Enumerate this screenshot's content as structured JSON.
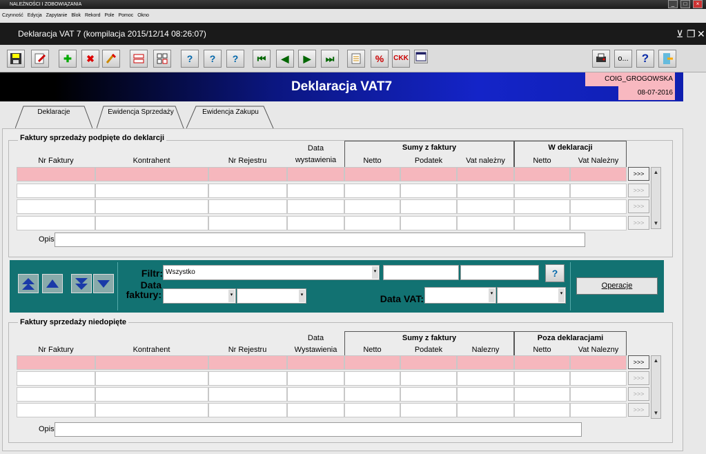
{
  "window": {
    "title": "NALEŻNOŚCI I ZOBOWIĄZANIA"
  },
  "menu": [
    "Czynność",
    "Edycja",
    "Zapytanie",
    "Blok",
    "Rekord",
    "Pole",
    "Pomoc",
    "Okno"
  ],
  "form": {
    "title": "Deklaracja VAT 7 (kompilacja 2015/12/14 08:26:07)"
  },
  "toolbar": {
    "icons": [
      "save-icon",
      "edit-icon",
      "add-icon",
      "delete-icon",
      "clear-icon",
      "duplicate-icon",
      "grid-icon",
      "query-icon",
      "query-exec-icon",
      "query-count-icon",
      "first-record-icon",
      "prev-record-icon",
      "next-record-icon",
      "last-record-icon",
      "list-icon",
      "percent-icon",
      "check-icon",
      "window-icon",
      "print-icon",
      "more-icon",
      "help-icon",
      "exit-icon"
    ],
    "more_label": "o..."
  },
  "banner": {
    "title": "Deklaracja VAT7",
    "user": "COIG_GROGOWSKA",
    "date": "08-07-2016"
  },
  "tabs": [
    "Deklaracje",
    "Ewidencja Sprzedaży",
    "Ewidencja Zakupu"
  ],
  "section1": {
    "title": "Faktury sprzedaży podpięte do deklarcji",
    "group1": "Sumy z faktury",
    "group2": "W deklaracji",
    "columns": [
      "Nr Faktury",
      "Kontrahent",
      "Nr Rejestru",
      "Data wystawienia",
      "Netto",
      "Podatek",
      "Vat należny",
      "Netto",
      "Vat Należny"
    ],
    "row_button": ">>>",
    "opis_label": "Opis"
  },
  "filter": {
    "filtr_label": "Filtr:",
    "filtr_value": "Wszystko",
    "data_faktury_label": "Data faktury:",
    "data_vat_label": "Data VAT:",
    "operacje_label": "Operacje"
  },
  "section2": {
    "title": "Faktury sprzedaży niedopięte",
    "group1": "Sumy z faktury",
    "group2": "Poza deklaracjami",
    "columns": [
      "Nr Faktury",
      "Kontrahent",
      "Nr Rejestru",
      "Data Wystawienia",
      "Netto",
      "Podatek",
      "Nalezny",
      "Netto",
      "Vat Nalezny"
    ],
    "row_button": ">>>",
    "opis_label": "Opis"
  }
}
